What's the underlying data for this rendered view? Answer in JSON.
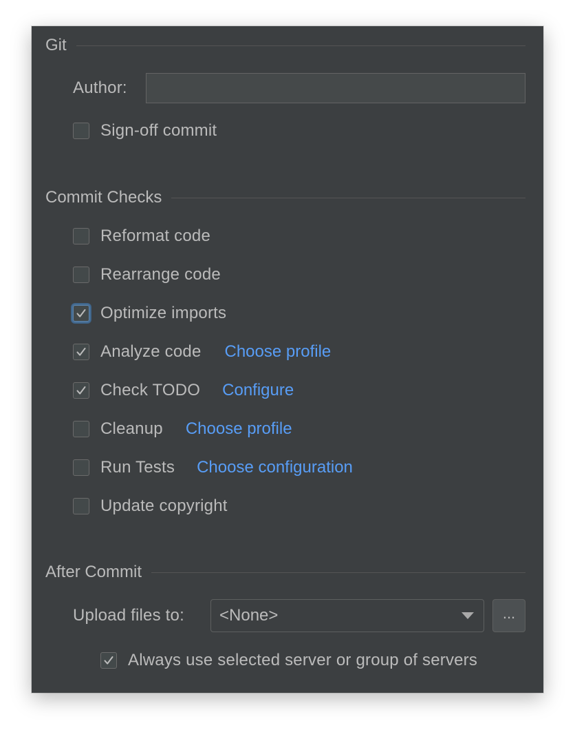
{
  "git": {
    "title": "Git",
    "author_label": "Author:",
    "author_value": "",
    "signoff": {
      "label": "Sign-off commit",
      "checked": false
    }
  },
  "commit_checks": {
    "title": "Commit Checks",
    "items": [
      {
        "label": "Reformat code",
        "checked": false
      },
      {
        "label": "Rearrange code",
        "checked": false
      },
      {
        "label": "Optimize imports",
        "checked": true,
        "focused": true
      },
      {
        "label": "Analyze code",
        "checked": true,
        "link": "Choose profile"
      },
      {
        "label": "Check TODO",
        "checked": true,
        "link": "Configure"
      },
      {
        "label": "Cleanup",
        "checked": false,
        "link": "Choose profile"
      },
      {
        "label": "Run Tests",
        "checked": false,
        "link": "Choose configuration"
      },
      {
        "label": "Update copyright",
        "checked": false
      }
    ]
  },
  "after_commit": {
    "title": "After Commit",
    "upload_label": "Upload files to:",
    "upload_value": "<None>",
    "browse_label": "...",
    "always_use": {
      "label": "Always use selected server or group of servers",
      "checked": true
    }
  },
  "colors": {
    "panel_bg": "#3c3f41",
    "text": "#bbbbbb",
    "link": "#589df6",
    "focus": "#466d94"
  },
  "icons": {
    "check": "check-mark-icon",
    "dropdown": "chevron-down-icon"
  }
}
